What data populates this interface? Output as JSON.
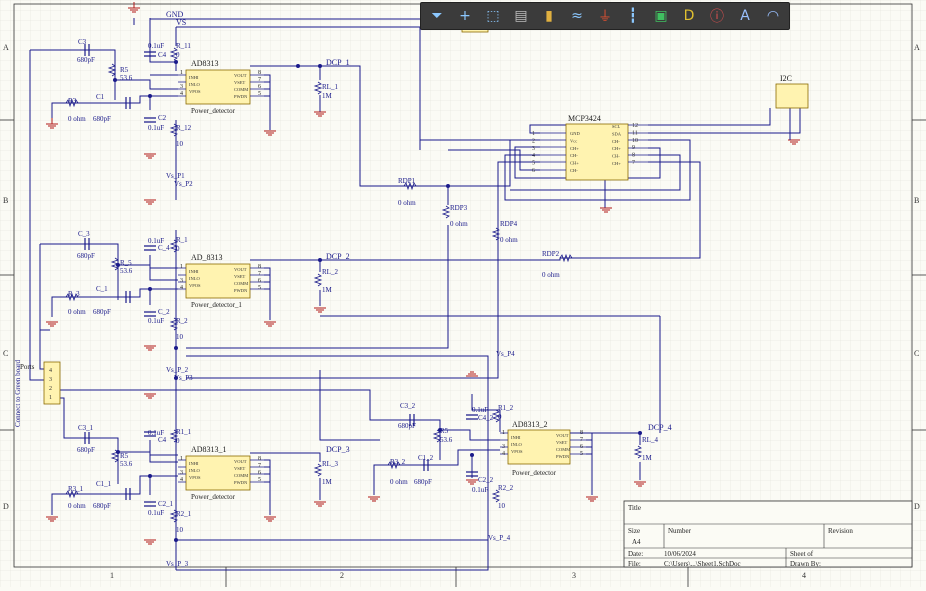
{
  "toolbar": {
    "tools": [
      {
        "icon": "filter-icon",
        "glyph": "⏷",
        "color": "#8cc8ff"
      },
      {
        "icon": "move-cross-icon",
        "glyph": "+",
        "color": "#8cc8ff"
      },
      {
        "icon": "select-rect-icon",
        "glyph": "⬚",
        "color": "#8cc8ff"
      },
      {
        "icon": "align-icon",
        "glyph": "▤",
        "color": "#bbbbbb"
      },
      {
        "icon": "component-icon",
        "glyph": "▮",
        "color": "#e0b040"
      },
      {
        "icon": "bus-icon",
        "glyph": "≈",
        "color": "#8cc8ff"
      },
      {
        "icon": "power-port-icon",
        "glyph": "⏚",
        "color": "#e05030"
      },
      {
        "icon": "harness-icon",
        "glyph": "┇",
        "color": "#8cc8ff"
      },
      {
        "icon": "sheet-symbol-icon",
        "glyph": "▣",
        "color": "#40c060"
      },
      {
        "icon": "directive-icon",
        "glyph": "D",
        "color": "#e0c030"
      },
      {
        "icon": "probe-icon",
        "glyph": "ⓘ",
        "color": "#e05050"
      },
      {
        "icon": "text-icon",
        "glyph": "A",
        "color": "#9ac0ff"
      },
      {
        "icon": "arc-icon",
        "glyph": "◠",
        "color": "#9ac0ff"
      }
    ]
  },
  "border": {
    "cols": [
      "1",
      "2",
      "3",
      "4"
    ],
    "rows": [
      "A",
      "B",
      "C",
      "D"
    ]
  },
  "title_block": {
    "title": "Title",
    "size_label": "Size",
    "size": "A4",
    "number_label": "Number",
    "revision_label": "Revision",
    "date_label": "Date:",
    "date": "10/06/2024",
    "file_label": "File:",
    "file": "C:\\Users\\...\\Sheet1.SchDoc",
    "sheet_label": "Sheet   of",
    "drawn_label": "Drawn By:"
  },
  "nets": {
    "gnd": "GND",
    "vs": "VS",
    "dcp1": "DCP_1",
    "dcp2": "DCP_2",
    "dcp3": "DCP_3",
    "dcp4": "DCP_4",
    "vsp1": "Vs_P1",
    "vsp2": "Vs_P2",
    "vsp3": "Vs_P3",
    "vsp4": "Vs_P4",
    "vsp_2": "Vs_P_2",
    "vsp_3": "Vs_P_3",
    "vsp_4": "Vs_P_4"
  },
  "ics": [
    {
      "ref": "AD8313",
      "name": "Power_detector"
    },
    {
      "ref": "AD_8313",
      "name": "Power_detector_1"
    },
    {
      "ref": "AD8313_1",
      "name": "Power_detector"
    },
    {
      "ref": "AD8313_2",
      "name": "Power_detector"
    }
  ],
  "pins_left": [
    "INHI",
    "INLO",
    "VPOS"
  ],
  "pins_right": [
    "VOUT",
    "VSET",
    "COMM",
    "PWDN"
  ],
  "mcp": {
    "ref": "MCP3424",
    "left": [
      "GND",
      "Vcc",
      "CH+",
      "CH-",
      "CH+",
      "CH-"
    ],
    "right": [
      "SCL",
      "SDA",
      "CH-",
      "CH+",
      "CH-",
      "CH+"
    ],
    "lnum": [
      "1",
      "2",
      "3",
      "4",
      "5",
      "6"
    ],
    "rnum": [
      "12",
      "11",
      "10",
      "9",
      "8",
      "7"
    ]
  },
  "i2c": {
    "ref": "I2C"
  },
  "ports": {
    "ref": "Ports",
    "side": "Connect to Green board",
    "pins": [
      "4",
      "3",
      "2",
      "1"
    ]
  },
  "parts": {
    "c3": "C3",
    "c3v": "680pF",
    "r5": "R5",
    "r5v": "53.6",
    "r3": "R3",
    "r3v": "0 ohm",
    "c1": "C1",
    "c1v": "680pF",
    "c4": "C4",
    "c4v": "0.1uF",
    "r11": "R_11",
    "r11v": "0",
    "c2": "C2",
    "c2v": "0.1uF",
    "r12": "R_12",
    "r12v": "10",
    "rl1": "RL_1",
    "rl1v": "1M",
    "c3b": "C_3",
    "c3bv": "680pF",
    "r5b": "R_5",
    "r5bv": "53.6",
    "r3b": "R_3",
    "r3bv": "0 ohm",
    "c1b": "C_1",
    "c1bv": "680pF",
    "c4b": "C_4",
    "c4bv": "0.1uF",
    "r1b": "R_1",
    "r1bv": "0",
    "c2b": "C_2",
    "c2bv": "0.1uF",
    "r2b": "R_2",
    "r2bv": "10",
    "rl2": "RL_2",
    "rl2v": "1M",
    "c3c": "C3_1",
    "c3cv": "680pF",
    "r5c": "R5",
    "r5cv": "53.6",
    "r3c": "R3_1",
    "r3cv": "0 ohm",
    "c1c": "C1_1",
    "c1cv": "680pF",
    "c4c": "C4",
    "c4cv": "0.1uF",
    "r1c": "R1_1",
    "r1cv": "0",
    "c2c": "C2_1",
    "c2cv": "0.1uF",
    "r2c": "R2_1",
    "r2cv": "10",
    "rl3": "RL_3",
    "rl3v": "1M",
    "c3d": "C3_2",
    "c3dv": "680pF",
    "r5d": "R5",
    "r5dv": "53.6",
    "r3d": "R3_2",
    "r3dv": "0 ohm",
    "c1d": "C1_2",
    "c1dv": "680pF",
    "c4d": "C4_2",
    "c4dv": "0.1uF",
    "r1d": "R1_2",
    "r1dv": "0",
    "c2d": "C2_2",
    "c2dv": "0.1uF",
    "r2d": "R2_2",
    "r2dv": "10",
    "rl4": "RL_4",
    "rl4v": "1M",
    "rdp1": "RDP1",
    "rdp1v": "0 ohm",
    "rdp2": "RDP2",
    "rdp2v": "0 ohm",
    "rdp3": "RDP3",
    "rdp3v": "0 ohm",
    "rdp4": "RDP4",
    "rdp4v": "0 ohm"
  }
}
